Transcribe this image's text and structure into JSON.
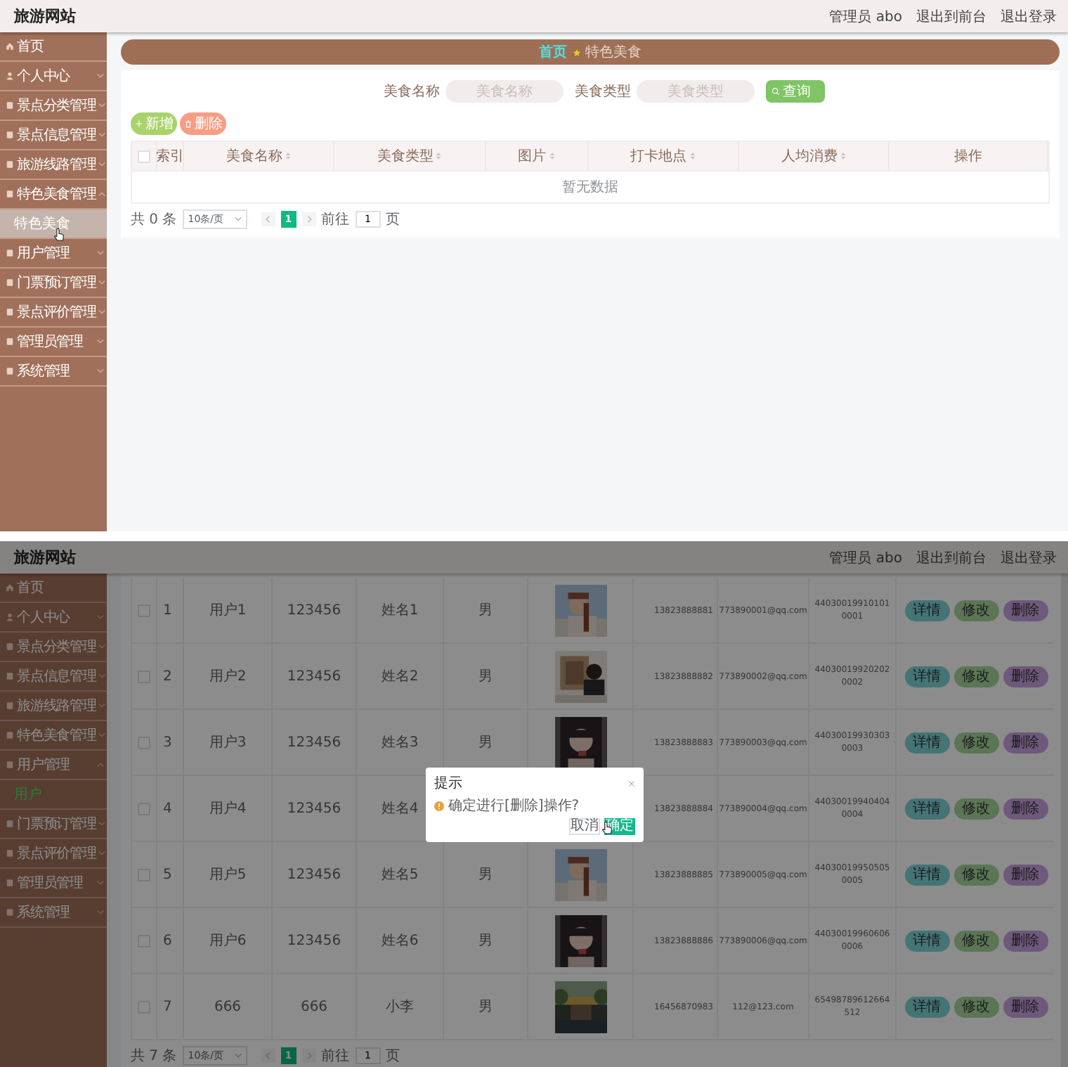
{
  "food_screen": {
    "header": {
      "title": "旅游网站",
      "user": "管理员 abo",
      "links": [
        "退出到前台",
        "退出登录"
      ]
    },
    "sidebar": [
      {
        "label": "首页"
      },
      {
        "label": "个人中心",
        "expanded": false
      },
      {
        "label": "景点分类管理",
        "expanded": false
      },
      {
        "label": "景点信息管理",
        "expanded": false
      },
      {
        "label": "旅游线路管理",
        "expanded": false
      },
      {
        "label": "特色美食管理",
        "expanded": true,
        "children": [
          {
            "label": "特色美食",
            "selected": true
          }
        ]
      },
      {
        "label": "用户管理",
        "expanded": false
      },
      {
        "label": "门票预订管理",
        "expanded": false
      },
      {
        "label": "景点评价管理",
        "expanded": false
      },
      {
        "label": "管理员管理",
        "expanded": false
      },
      {
        "label": "系统管理",
        "expanded": false
      }
    ],
    "breadcrumb": [
      "首页",
      "特色美食"
    ],
    "search": [
      {
        "label": "美食名称",
        "placeholder": "美食名称"
      },
      {
        "label": "美食类型",
        "placeholder": "美食类型"
      }
    ],
    "search_button": "查询",
    "actions": [
      {
        "label": "新增",
        "kind": "add"
      },
      {
        "label": "删除",
        "kind": "delete"
      }
    ],
    "columns": [
      {
        "label": "索引",
        "sortable": false
      },
      {
        "label": "美食名称",
        "sortable": true
      },
      {
        "label": "美食类型",
        "sortable": true
      },
      {
        "label": "图片",
        "sortable": true
      },
      {
        "label": "打卡地点",
        "sortable": true
      },
      {
        "label": "人均消费",
        "sortable": true
      },
      {
        "label": "操作",
        "sortable": false
      }
    ],
    "select_all_checked": false,
    "empty_text": "暂无数据",
    "pagination": {
      "total": "共 0 条",
      "page_size": "10条/页",
      "pages": [
        {
          "label": "1",
          "selected": true
        }
      ],
      "goto": "前往",
      "page": "1",
      "unit": "页"
    }
  },
  "user_screen": {
    "header": {
      "title": "旅游网站",
      "user": "管理员 abo",
      "links": [
        "退出到前台",
        "退出登录"
      ]
    },
    "sidebar": [
      {
        "label": "首页"
      },
      {
        "label": "个人中心",
        "expanded": false
      },
      {
        "label": "景点分类管理",
        "expanded": false
      },
      {
        "label": "景点信息管理",
        "expanded": false
      },
      {
        "label": "旅游线路管理",
        "expanded": false
      },
      {
        "label": "特色美食管理",
        "expanded": false
      },
      {
        "label": "用户管理",
        "expanded": true,
        "children": [
          {
            "label": "用户",
            "selected": true
          }
        ]
      },
      {
        "label": "门票预订管理",
        "expanded": false
      },
      {
        "label": "景点评价管理",
        "expanded": false
      },
      {
        "label": "管理员管理",
        "expanded": false
      },
      {
        "label": "系统管理",
        "expanded": false
      }
    ],
    "rows": [
      {
        "checked": false,
        "index": "1",
        "username": "用户1",
        "password": "123456",
        "name": "姓名1",
        "gender": "男",
        "phone": "13823888881",
        "email": "773890001@qq.com",
        "id_number": "440300199101010001",
        "actions": [
          "详情",
          "修改",
          "删除"
        ]
      },
      {
        "checked": false,
        "index": "2",
        "username": "用户2",
        "password": "123456",
        "name": "姓名2",
        "gender": "男",
        "phone": "13823888882",
        "email": "773890002@qq.com",
        "id_number": "440300199202020002",
        "actions": [
          "详情",
          "修改",
          "删除"
        ]
      },
      {
        "checked": false,
        "index": "3",
        "username": "用户3",
        "password": "123456",
        "name": "姓名3",
        "gender": "男",
        "phone": "13823888883",
        "email": "773890003@qq.com",
        "id_number": "440300199303030003",
        "actions": [
          "详情",
          "修改",
          "删除"
        ]
      },
      {
        "checked": false,
        "index": "4",
        "username": "用户4",
        "password": "123456",
        "name": "姓名4",
        "phone": "13823888884",
        "email": "773890004@qq.com",
        "id_number": "440300199404040004",
        "actions": [
          "详情",
          "修改",
          "删除"
        ]
      },
      {
        "checked": false,
        "index": "5",
        "username": "用户5",
        "password": "123456",
        "name": "姓名5",
        "gender": "男",
        "phone": "13823888885",
        "email": "773890005@qq.com",
        "id_number": "440300199505050005",
        "actions": [
          "详情",
          "修改",
          "删除"
        ]
      },
      {
        "checked": false,
        "index": "6",
        "username": "用户6",
        "password": "123456",
        "name": "姓名6",
        "gender": "男",
        "phone": "13823888886",
        "email": "773890006@qq.com",
        "id_number": "440300199606060006",
        "actions": [
          "详情",
          "修改",
          "删除"
        ]
      },
      {
        "checked": false,
        "index": "7",
        "username": "666",
        "password": "666",
        "name": "小李",
        "gender": "男",
        "phone": "16456870983",
        "email": "112@123.com",
        "id_number": "65498789612664512",
        "actions": [
          "详情",
          "修改",
          "删除"
        ]
      }
    ],
    "pagination": {
      "total": "共 7 条",
      "page_size": "10条/页",
      "pages": [
        {
          "label": "1",
          "selected": true
        }
      ],
      "goto": "前往",
      "page": "1",
      "unit": "页"
    },
    "dialog": {
      "title": "提示",
      "message": "确定进行[删除]操作?",
      "buttons": [
        {
          "label": "取消",
          "kind": "default"
        },
        {
          "label": "确定",
          "kind": "primary"
        }
      ]
    }
  }
}
